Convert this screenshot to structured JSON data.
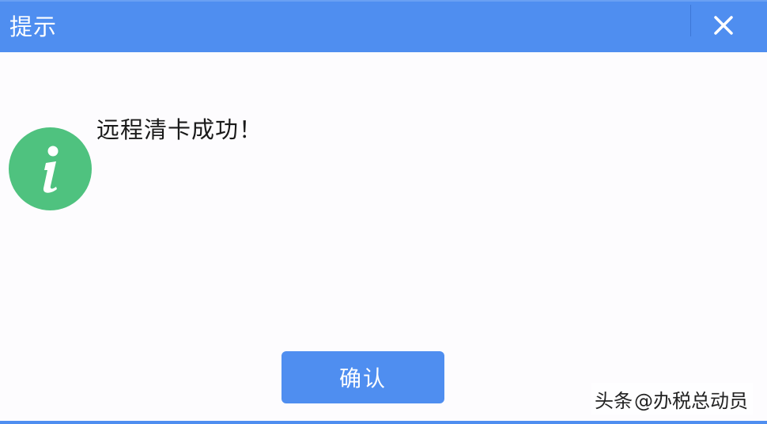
{
  "dialog": {
    "title": "提示",
    "close_icon": "close-icon",
    "info_icon": "info-icon",
    "message": "远程清卡成功！",
    "ok_label": "确认"
  },
  "watermark": {
    "prefix": "头条",
    "handle": "@办税总动员"
  },
  "colors": {
    "titlebar": "#4f8ef0",
    "button": "#4f8ef0",
    "info_icon": "#4fc27f",
    "background": "#fdfcfe"
  }
}
